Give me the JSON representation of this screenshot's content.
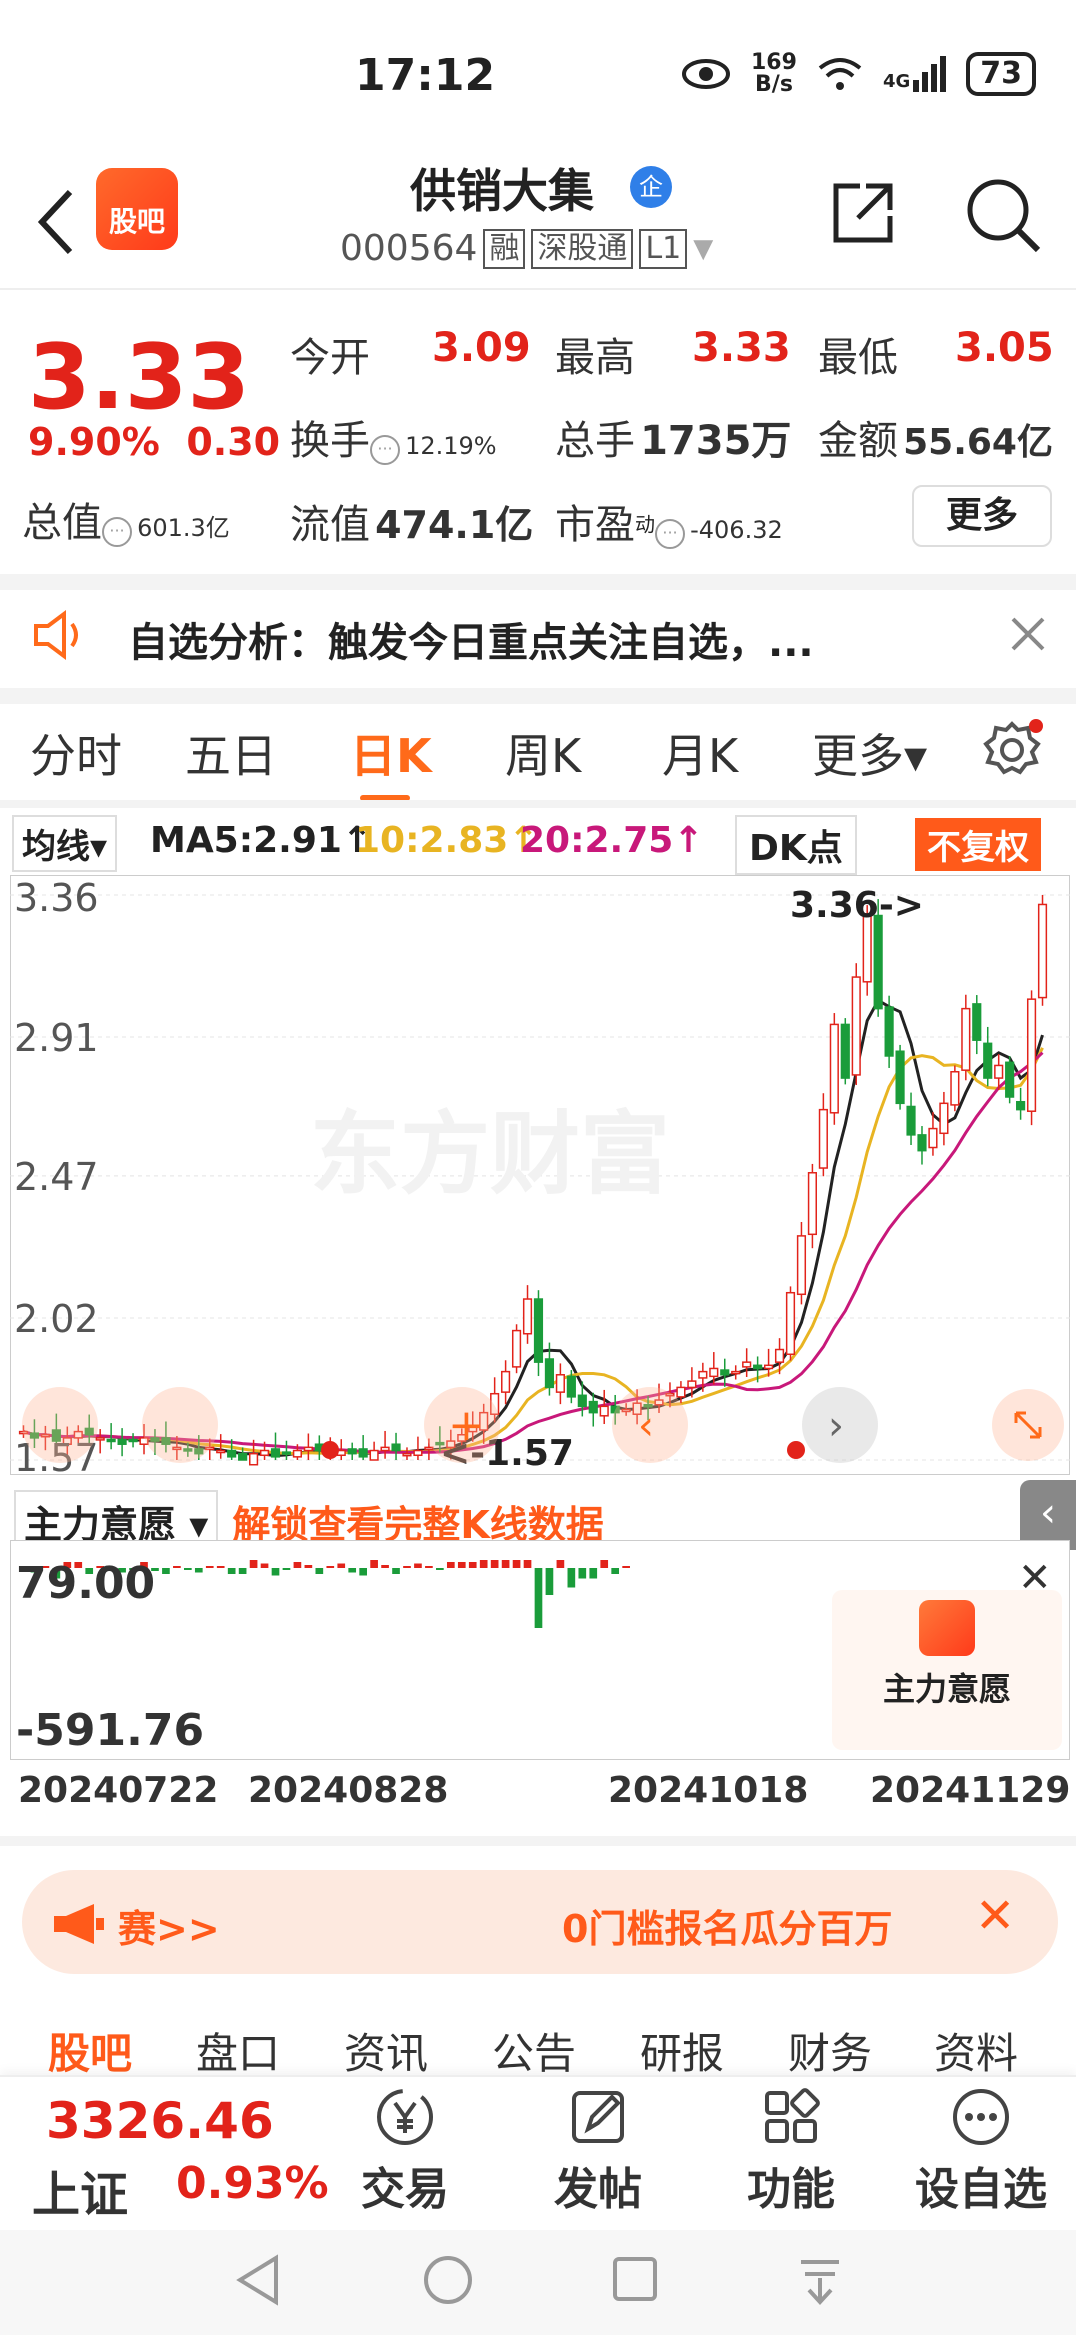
{
  "status_bar": {
    "time": "17:12",
    "net_speed_top": "169",
    "net_speed_bottom": "B/s",
    "network": "4G",
    "battery": "73"
  },
  "header": {
    "logo_text": "股吧",
    "stock_name": "供销大集",
    "name_badge": "企",
    "stock_code": "000564",
    "tags": [
      "融",
      "深股通",
      "L1"
    ]
  },
  "quote": {
    "price": "3.33",
    "change_pct": "9.90%",
    "change": "0.30",
    "open_label": "今开",
    "open": "3.09",
    "high_label": "最高",
    "high": "3.33",
    "low_label": "最低",
    "low": "3.05",
    "turnover_label": "换手",
    "turnover": "12.19%",
    "volume_label": "总手",
    "volume": "1735万",
    "amount_label": "金额",
    "amount": "55.64亿",
    "mktcap_label": "总值",
    "mktcap": "601.3亿",
    "float_label": "流值",
    "float_cap": "474.1亿",
    "pe_label": "市盈",
    "pe_sup": "动",
    "pe": "-406.32",
    "more_label": "更多"
  },
  "notice": {
    "text": "自选分析：触发今日重点关注自选，..."
  },
  "chart_tabs": [
    "分时",
    "五日",
    "日K",
    "周K",
    "月K",
    "更多▾"
  ],
  "ma_bar": {
    "selector": "均线▾",
    "ma5": "MA5:2.91↑",
    "ma10": "10:2.83↑",
    "ma20": "20:2.75↑",
    "dk": "DK点",
    "fq": "不复权"
  },
  "colors": {
    "up": "#e2231a",
    "down": "#1a9c3a",
    "ma5": "#222222",
    "ma10": "#e8b422",
    "ma20": "#c8187a",
    "accent": "#ff5a1a"
  },
  "chart_data": {
    "type": "candlestick",
    "y_ticks": [
      "3.36",
      "2.91",
      "2.47",
      "2.02",
      "1.57"
    ],
    "ylim": [
      1.57,
      3.36
    ],
    "watermark": "东方财富",
    "annotations": {
      "high": "3.36->",
      "low": "<-1.57"
    },
    "x_ticks": [
      "20240722",
      "20240828",
      "20241018",
      "20241129"
    ],
    "close": [
      1.66,
      1.64,
      1.65,
      1.63,
      1.64,
      1.66,
      1.65,
      1.64,
      1.63,
      1.62,
      1.63,
      1.64,
      1.63,
      1.62,
      1.61,
      1.6,
      1.59,
      1.61,
      1.6,
      1.58,
      1.57,
      1.59,
      1.6,
      1.58,
      1.59,
      1.6,
      1.61,
      1.6,
      1.59,
      1.6,
      1.59,
      1.58,
      1.6,
      1.61,
      1.6,
      1.59,
      1.6,
      1.61,
      1.62,
      1.63,
      1.65,
      1.68,
      1.72,
      1.78,
      1.85,
      1.98,
      2.08,
      1.88,
      1.8,
      1.84,
      1.77,
      1.74,
      1.72,
      1.74,
      1.72,
      1.73,
      1.75,
      1.74,
      1.76,
      1.78,
      1.8,
      1.82,
      1.85,
      1.86,
      1.84,
      1.85,
      1.88,
      1.86,
      1.87,
      1.92,
      2.1,
      2.28,
      2.48,
      2.68,
      2.95,
      2.78,
      3.1,
      3.3,
      3.0,
      2.85,
      2.7,
      2.6,
      2.55,
      2.62,
      2.7,
      2.8,
      3.0,
      2.9,
      2.78,
      2.82,
      2.72,
      2.68,
      3.03,
      3.33
    ],
    "indicator": {
      "name": "主力意愿",
      "unlock_text": "解锁查看完整K线数据",
      "y_ticks": [
        "79.00",
        "-591.76"
      ],
      "card_label": "主力意愿"
    }
  },
  "banner": {
    "left": "赛>>",
    "right": "0门槛报名瓜分百万"
  },
  "bottom_tabs": [
    "股吧",
    "盘口",
    "资讯",
    "公告",
    "研报",
    "财务",
    "资料"
  ],
  "bottom_nav": {
    "index_value": "3326.46",
    "index_name": "上证",
    "index_pct": "0.93%",
    "items": [
      "交易",
      "发帖",
      "功能",
      "设自选"
    ]
  }
}
